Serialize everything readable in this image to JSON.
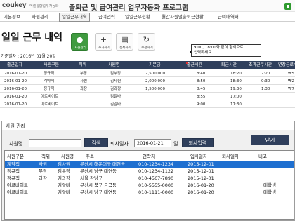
{
  "header": {
    "logo_main": "coukey",
    "logo_accent": "KEY",
    "logo_tagline": "엑셀통합업무자동화",
    "app_title": "출퇴근 및 급여관리 업무자동화 프로그램"
  },
  "menu": [
    "기본정보",
    "사원관리",
    "일일근무내역",
    "급여입력",
    "일일근무현황",
    "월간사원별출퇴근현황",
    "급여내역서"
  ],
  "page": {
    "title": "일일 근무 내역",
    "reference_date": "기준일자 : 2016년 01월 20일"
  },
  "toolbar": [
    {
      "label": "사원관리",
      "icon": "person-icon",
      "glyph": "●"
    },
    {
      "label": "추가하기",
      "icon": "plus-icon",
      "glyph": "+"
    },
    {
      "label": "등록하기",
      "icon": "document-icon",
      "glyph": "▤"
    },
    {
      "label": "수정하기",
      "icon": "refresh-icon",
      "glyph": "↻"
    }
  ],
  "note": {
    "line1": "9:00, 18:00와 같이 형식으로",
    "line2": "입력하세요."
  },
  "grid": {
    "columns": [
      "출근일자",
      "사원구분",
      "직위",
      "사원명",
      "기본급",
      "출근시간",
      "퇴근시간",
      "초과근무시간",
      "연장근로수"
    ],
    "rows": [
      [
        "2016-01-20",
        "정규직",
        "부장",
        "김부장",
        "2,500,000",
        "8:40",
        "18:20",
        "2:20",
        "₩5"
      ],
      [
        "2016-01-20",
        "계약직",
        "사원",
        "김사원",
        "2,000,000",
        "8:50",
        "18:30",
        "0:30",
        "₩2"
      ],
      [
        "2016-01-20",
        "정규직",
        "과장",
        "김과장",
        "1,500,000",
        "8:45",
        "19:30",
        "1:30",
        "₩7"
      ],
      [
        "2016-01-20",
        "아르바이트",
        "",
        "김알바",
        "",
        "8:55",
        "17:00",
        "",
        ""
      ],
      [
        "2016-01-20",
        "아르바이트",
        "",
        "김알바",
        "",
        "9:00",
        "17:30",
        "",
        ""
      ]
    ]
  },
  "dialog": {
    "title": "사원 관리",
    "name_label": "사원명",
    "name_value": "",
    "search_button": "검색",
    "retire_label": "퇴사일자",
    "retire_date": "2016-01-21",
    "retire_suffix": "일",
    "retire_button": "퇴사입력",
    "close_button": "닫기",
    "columns": [
      "사원구분",
      "직위",
      "사원명",
      "주소",
      "연락처",
      "입사일자",
      "퇴사일자",
      "비고"
    ],
    "rows": [
      [
        "계약직",
        "사원",
        "김사원",
        "부산시 해운대구 대연동",
        "010-1234-1234",
        "2015-12-01",
        "",
        ""
      ],
      [
        "정규직",
        "부장",
        "김부장",
        "부산시 남구 대연동",
        "010-1234-1122",
        "2015-12-01",
        "",
        ""
      ],
      [
        "정규직",
        "과장",
        "김과장",
        "서울 강남구",
        "010-4567-7890",
        "2015-12-01",
        "",
        ""
      ],
      [
        "아르바이트",
        "",
        "김알바",
        "부산시 북구 금곡동",
        "010-5555-0000",
        "2016-01-20",
        "",
        "대학생"
      ],
      [
        "아르바이트",
        "",
        "김알바",
        "부산시 남구 대연동",
        "010-1111-0000",
        "2016-01-20",
        "",
        "대학생"
      ]
    ],
    "selected_row": 0
  },
  "colors": {
    "header_navy": "#2f3f5c",
    "selection_blue": "#1e6fd0",
    "accent_green": "#3f9a3f"
  }
}
